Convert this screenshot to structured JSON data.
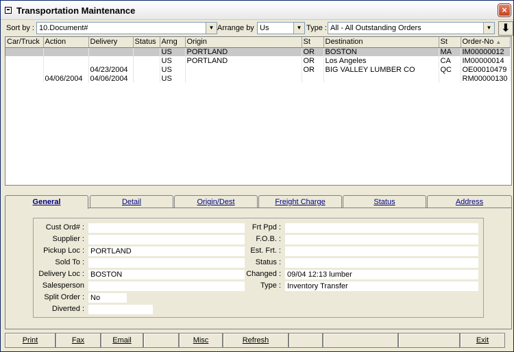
{
  "window": {
    "title": "Transportation Maintenance",
    "close_label": "×"
  },
  "toolbar": {
    "sort_label": "Sort by :",
    "sort_value": "10.Document#",
    "arrange_label": "Arrange by :",
    "arrange_value": "Us",
    "type_label": "Type :",
    "type_value": "All - All Outstanding Orders",
    "sort_direction_glyph": "⬇",
    "dropdown_glyph": "▼"
  },
  "grid": {
    "columns": [
      "Car/Truck",
      "Action",
      "Delivery",
      "Status",
      "Arng",
      "Origin",
      "St",
      "Destination",
      "St",
      "Order-No"
    ],
    "sort_glyph": "▲",
    "rows": [
      [
        "",
        "",
        "",
        "",
        "US",
        "PORTLAND",
        "OR",
        "BOSTON",
        "MA",
        "IM00000012"
      ],
      [
        "",
        "",
        "",
        "",
        "US",
        "PORTLAND",
        "OR",
        "Los Angeles",
        "CA",
        "IM00000014"
      ],
      [
        "",
        "",
        "04/23/2004",
        "",
        "US",
        "",
        "OR",
        "BIG VALLEY LUMBER CO",
        "QC",
        "OE00010479"
      ],
      [
        "",
        "04/06/2004",
        "04/06/2004",
        "",
        "US",
        "",
        "",
        "",
        "",
        "RM00000130"
      ]
    ]
  },
  "tabs": [
    "General",
    "Detail",
    "Origin/Dest",
    "Freight Charge",
    "Status",
    "Address"
  ],
  "general": {
    "left": [
      {
        "label": "Cust Ord# :",
        "value": ""
      },
      {
        "label": "Supplier :",
        "value": ""
      },
      {
        "label": "Pickup Loc :",
        "value": "PORTLAND"
      },
      {
        "label": "Sold To :",
        "value": ""
      },
      {
        "label": "Delivery Loc :",
        "value": "BOSTON"
      },
      {
        "label": "Salesperson",
        "value": ""
      },
      {
        "label": "Split Order :",
        "value": "No"
      },
      {
        "label": "Diverted :",
        "value": ""
      }
    ],
    "right": [
      {
        "label": "Frt Ppd :",
        "value": ""
      },
      {
        "label": "F.O.B. :",
        "value": ""
      },
      {
        "label": "Est. Frt. :",
        "value": ""
      },
      {
        "label": "Status :",
        "value": ""
      },
      {
        "label": "Changed :",
        "value": "09/04 12:13 lumber"
      },
      {
        "label": "Type :",
        "value": "Inventory Transfer"
      }
    ]
  },
  "buttons": [
    "Print",
    "Fax",
    "Email",
    "",
    "Misc",
    "Refresh",
    "",
    "",
    "",
    "Exit"
  ]
}
